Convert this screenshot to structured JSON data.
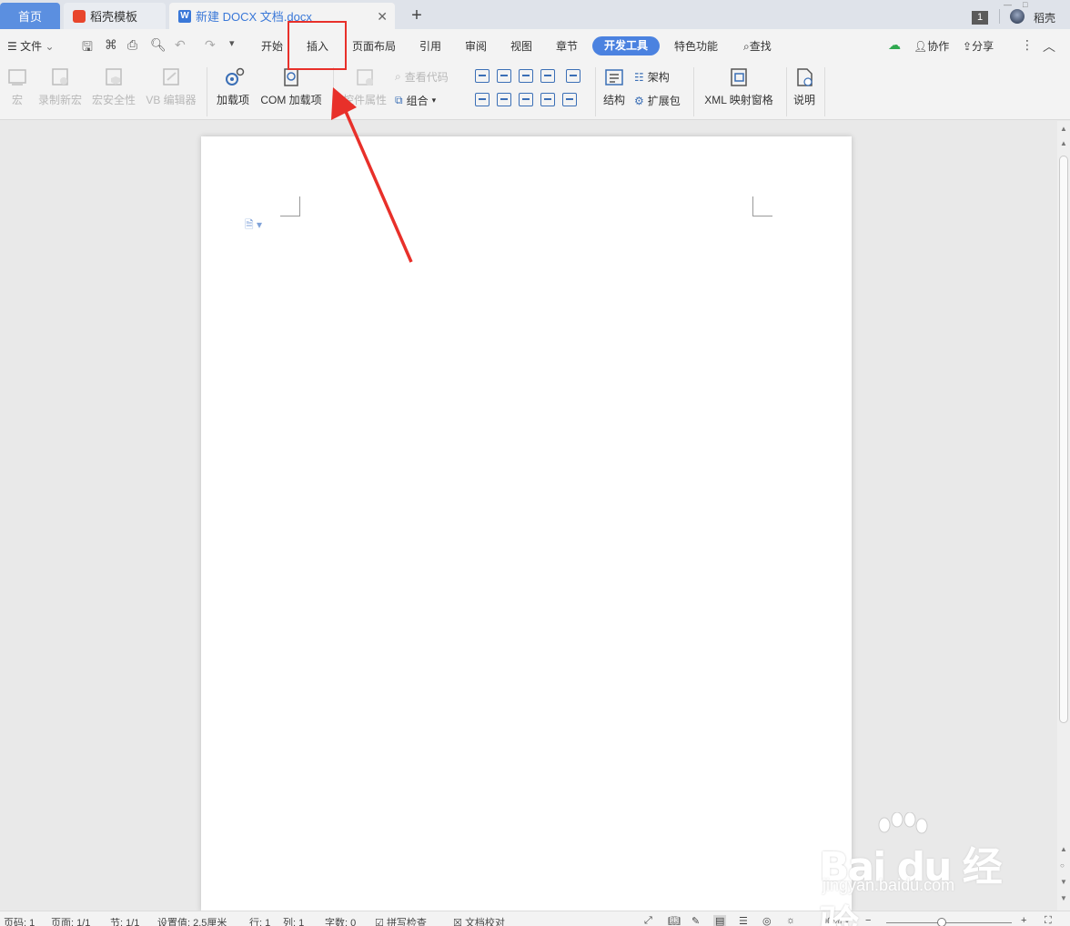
{
  "tabs": {
    "home": "首页",
    "template": "稻壳模板",
    "document": "新建 DOCX 文档.docx",
    "new_tab": "+",
    "window_count": "1",
    "user": "稻壳"
  },
  "menu": {
    "file": "文件",
    "items": [
      "开始",
      "插入",
      "页面布局",
      "引用",
      "审阅",
      "视图",
      "章节",
      "开发工具",
      "特色功能"
    ],
    "search": "查找",
    "collaborate": "协作",
    "share": "分享"
  },
  "ribbon": {
    "macro": "宏",
    "record_macro": "录制新宏",
    "macro_security": "宏安全性",
    "vb_editor": "VB 编辑器",
    "addins": "加载项",
    "com_addins": "COM 加载项",
    "control_props": "控件属性",
    "view_code": "查看代码",
    "group": "组合",
    "structure": "结构",
    "schema": "架构",
    "expansion_pack": "扩展包",
    "xml_pane": "XML 映射窗格",
    "help": "说明"
  },
  "status": {
    "page_num": "页码: 1",
    "pages": "页面: 1/1",
    "section": "节: 1/1",
    "setting": "设置值: 2.5厘米",
    "row": "行: 1",
    "col": "列: 1",
    "word_count": "字数: 0",
    "spell_check": "拼写检查",
    "doc_proof": "文档校对",
    "zoom": "90%"
  },
  "watermark": {
    "brand": "Bai du 经验",
    "url": "jingyan.baidu.com"
  },
  "colors": {
    "accent": "#4b82e0",
    "annotation": "#e8302a"
  }
}
